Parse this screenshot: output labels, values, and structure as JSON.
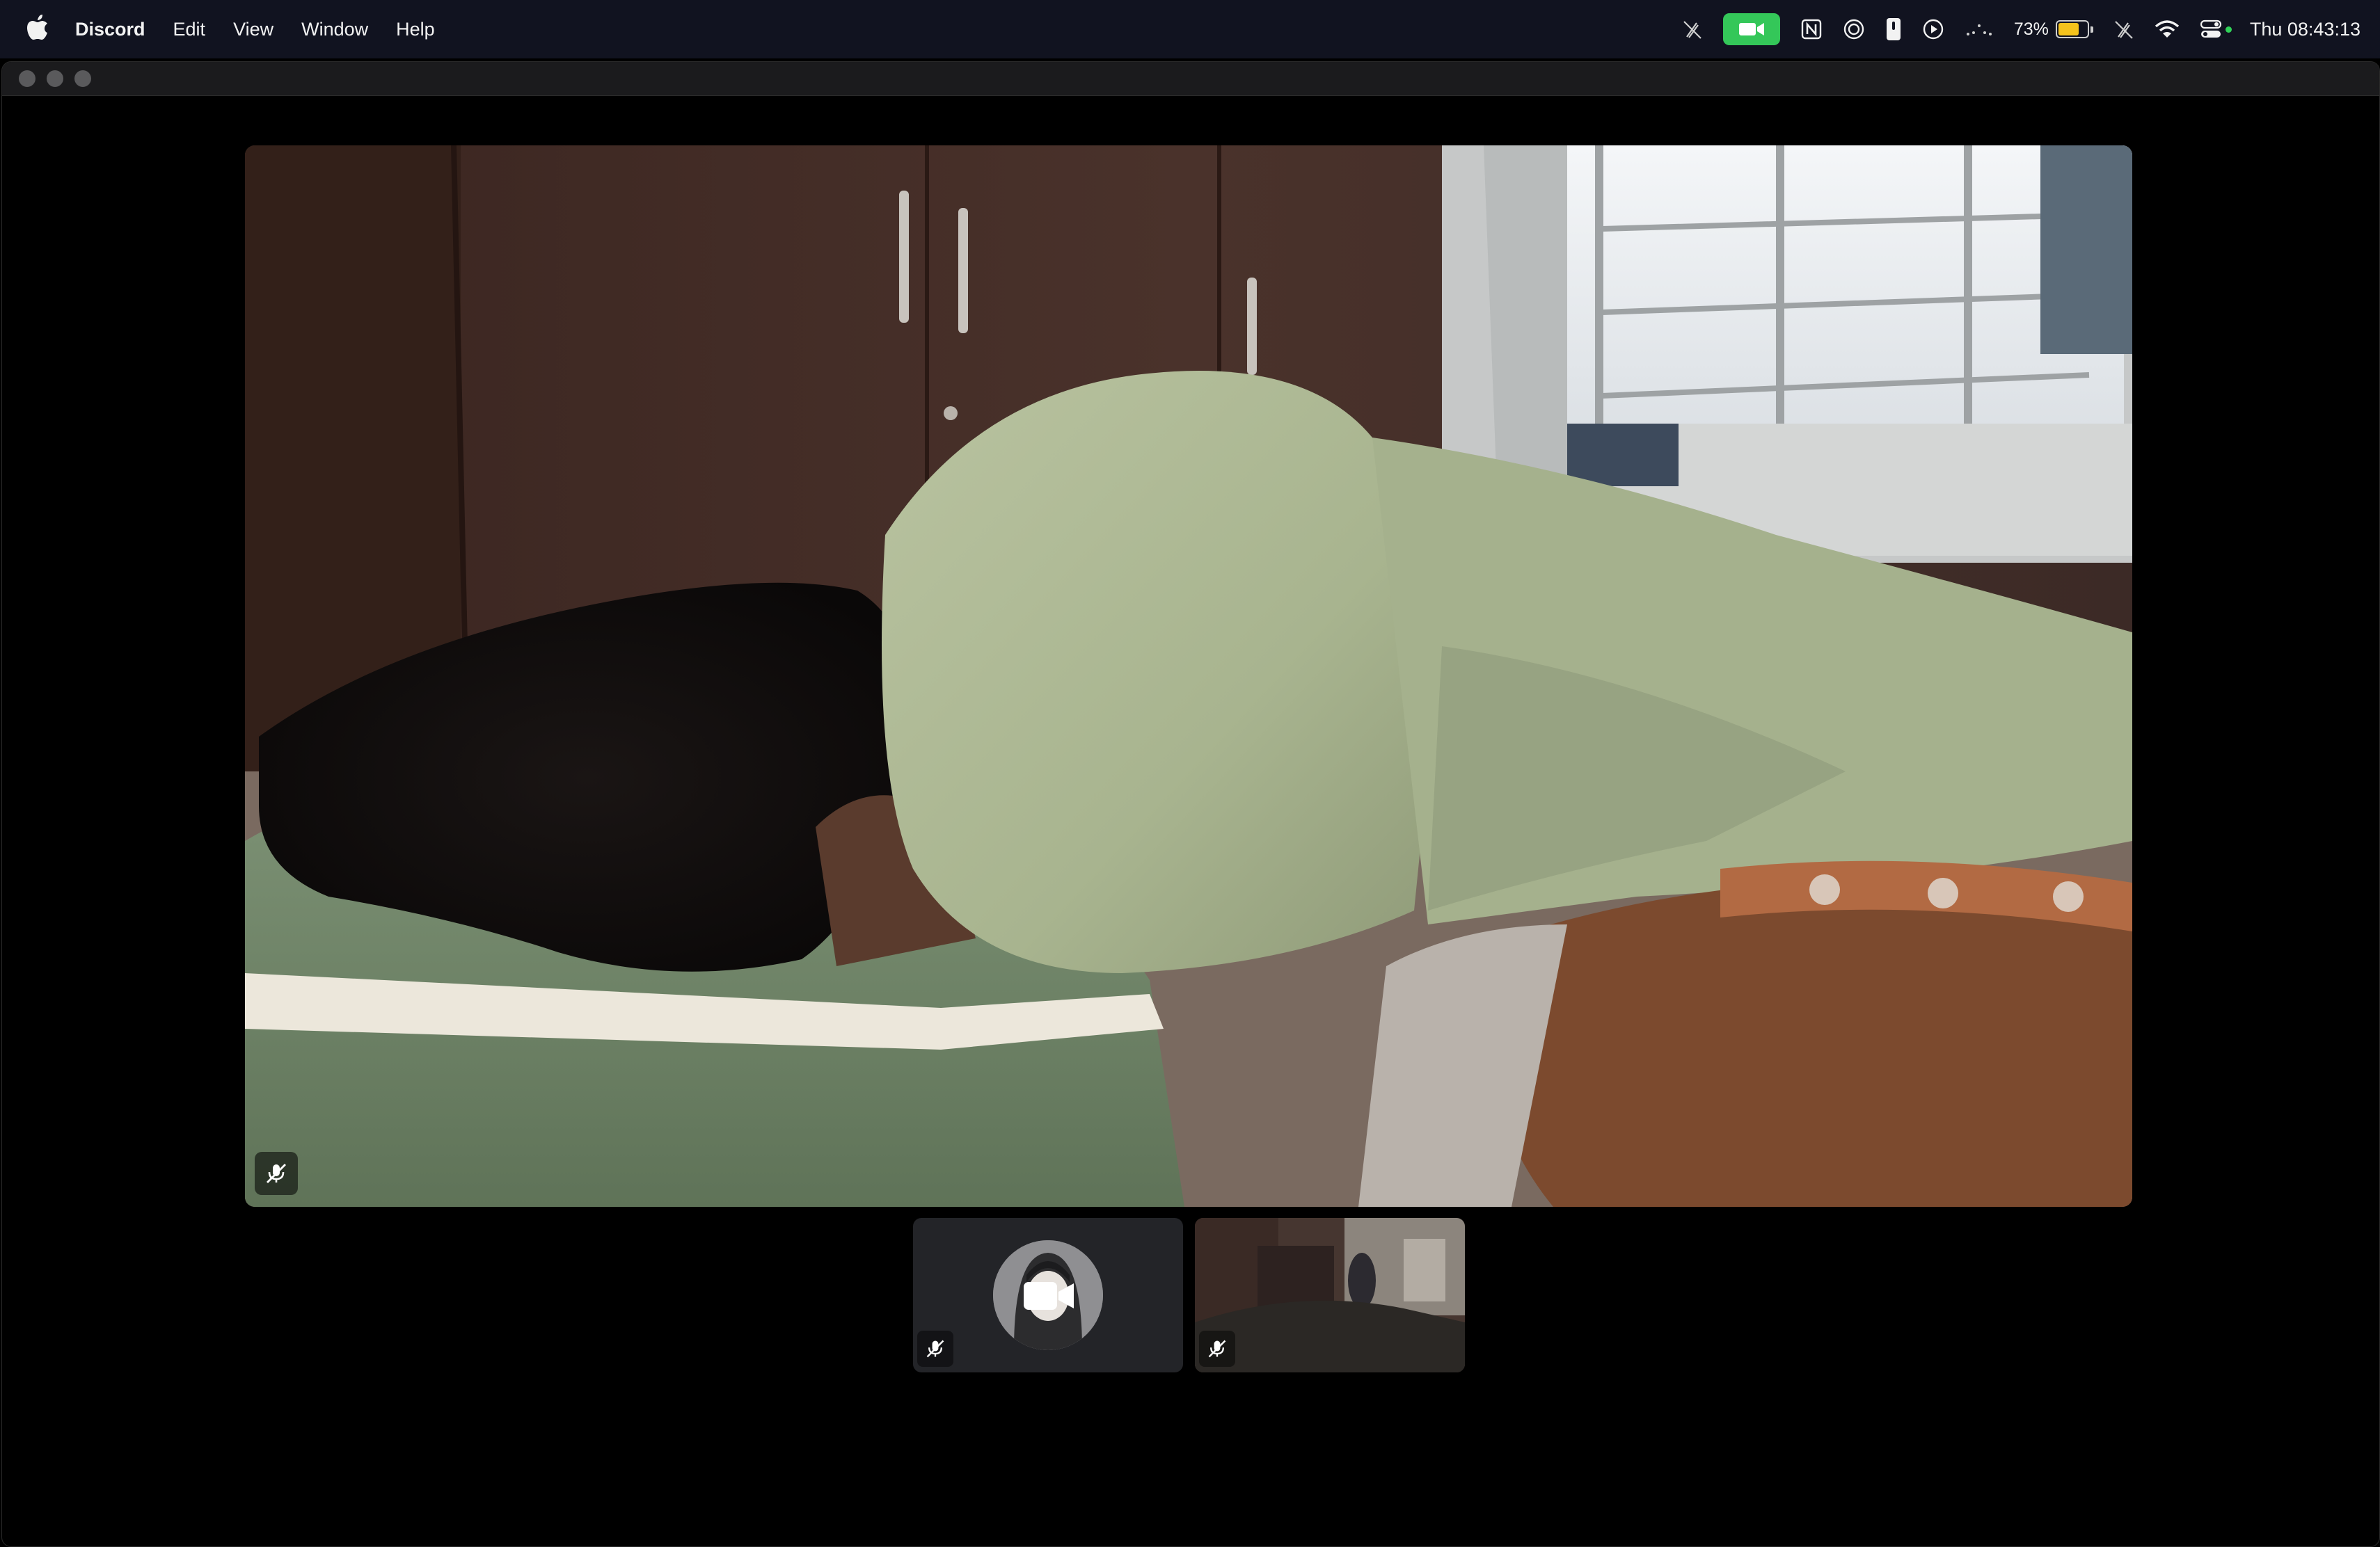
{
  "menubar": {
    "app_name": "Discord",
    "menus": [
      "Edit",
      "View",
      "Window",
      "Help"
    ],
    "battery_percent": "73%",
    "battery_level": 0.73,
    "clock": "Thu 08:43:13",
    "icons": [
      "apple-icon",
      "pen-slash-icon",
      "facetime-camera-icon",
      "notion-icon",
      "screen-record-icon",
      "usb-drive-icon",
      "play-circle-icon",
      "wave-icon",
      "battery-icon",
      "pen-slash-icon",
      "wifi-icon",
      "control-center-icon"
    ],
    "colors": {
      "camera_active": "#34c759",
      "battery_fill": "#f5c31c",
      "bar_bg": "#111320"
    }
  },
  "window": {
    "traffic_lights": [
      "close",
      "minimize",
      "zoom"
    ]
  },
  "call": {
    "main_stream": {
      "participant": "video-feed",
      "muted": true
    },
    "tiles": [
      {
        "kind": "avatar-camera-off",
        "muted": true
      },
      {
        "kind": "video-feed",
        "muted": true
      }
    ]
  }
}
